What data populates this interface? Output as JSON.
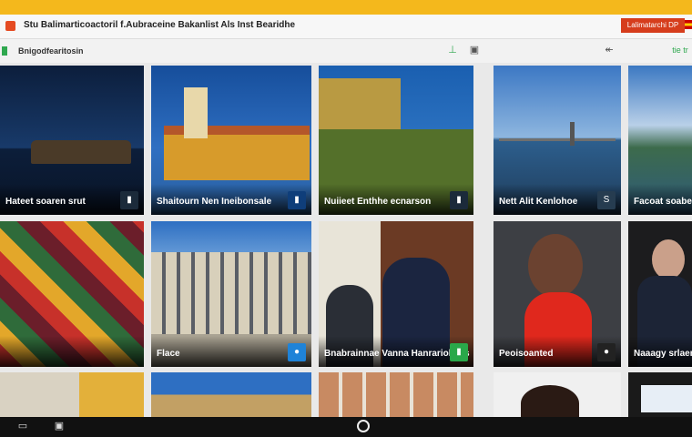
{
  "titlebar": {
    "title": "Stu Balimarticoactoril f.Aubraceine Bakanlist Als Inst Bearidhe",
    "cta_label": "Lalimatarchi DP"
  },
  "toolbar": {
    "breadcrumb": "Bnigodfearitosin",
    "right_label": "tie tr"
  },
  "tiles": [
    {
      "label": "Hateet soaren srut",
      "badge": "▮"
    },
    {
      "label": "Shaitourn Nen Ineibonsale",
      "badge": "▮"
    },
    {
      "label": "Nuiieet Enthhe ecnarson",
      "badge": "▮"
    },
    {
      "label": "Nett Alit Kenlohoe",
      "badge": "S"
    },
    {
      "label": "Facoat soaber",
      "badge": ""
    },
    {
      "label": "",
      "badge": ""
    },
    {
      "label": "Flace",
      "badge": "●"
    },
    {
      "label": "Bnabrainnae Vanna Hanrariohaes",
      "badge": "▮"
    },
    {
      "label": "Peoisoanted",
      "badge": "●"
    },
    {
      "label": "Naaagy srlaen",
      "badge": ""
    }
  ]
}
